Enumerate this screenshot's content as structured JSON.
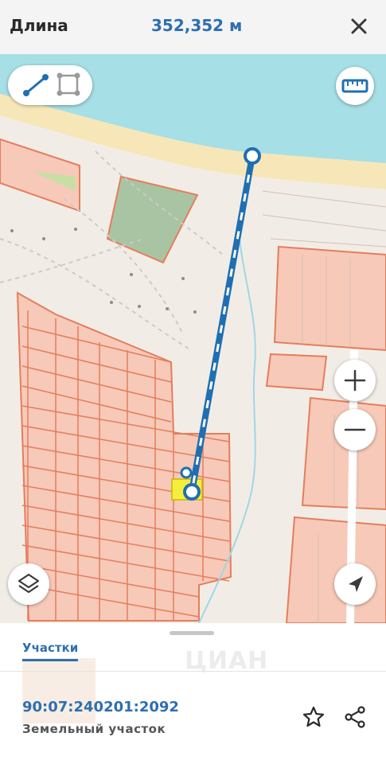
{
  "header": {
    "label": "Длина",
    "value": "352,352 м"
  },
  "map": {
    "colors": {
      "water": "#a6dfe6",
      "beach": "#f7e7b8",
      "parcel_fill": "#f7c9b8",
      "parcel_stroke": "#e57d5d",
      "selected_fill": "#f5ee3c",
      "measure_line": "#1f6fb2"
    }
  },
  "sheet": {
    "tab_label": "Участки",
    "watermark": "ЦИАН",
    "cadastral_number": "90:07:240201:2092",
    "parcel_type": "Земельный участок"
  },
  "icons": {
    "close": "close-icon",
    "line_mode": "line-tool-icon",
    "area_mode": "area-tool-icon",
    "ruler": "ruler-icon",
    "zoom_in": "plus-icon",
    "zoom_out": "minus-icon",
    "layers": "layers-icon",
    "locate": "location-arrow-icon",
    "favorite": "star-icon",
    "share": "share-icon"
  }
}
